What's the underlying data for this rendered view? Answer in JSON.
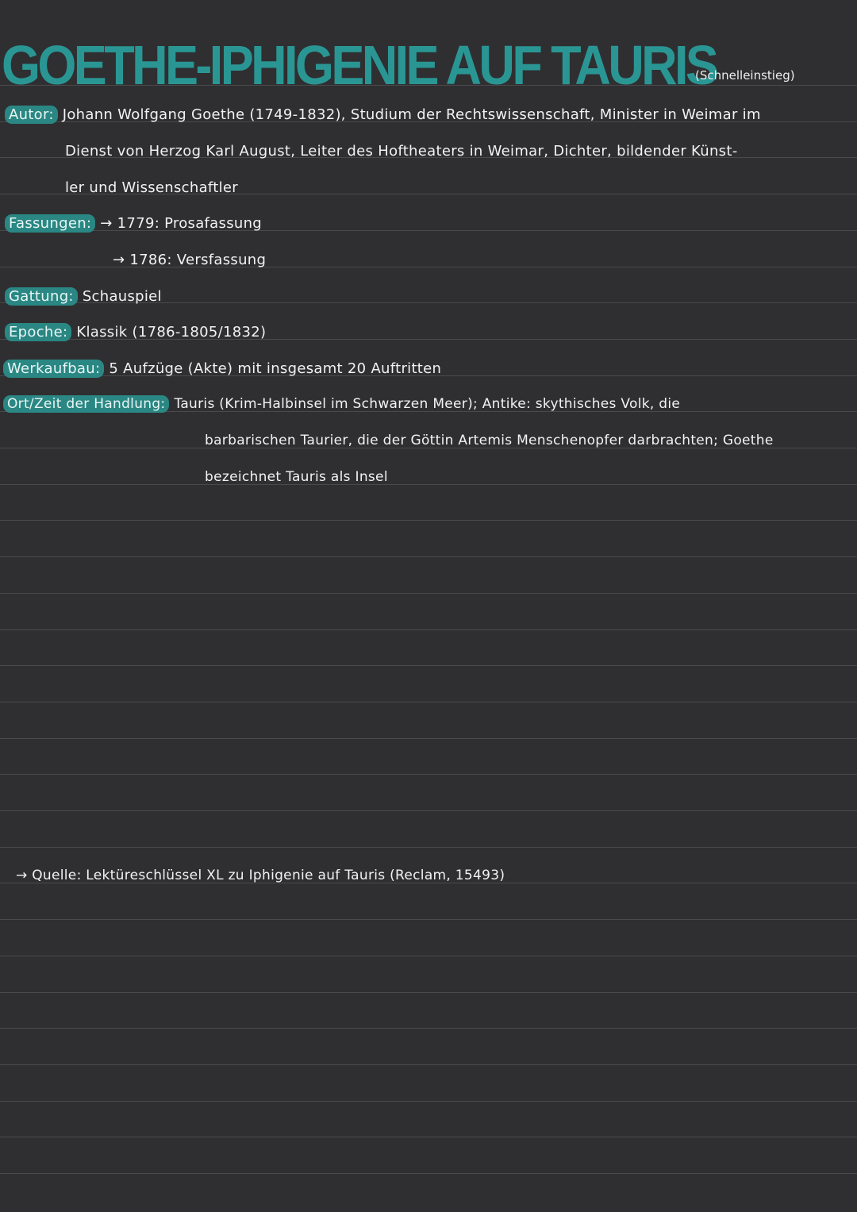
{
  "title": "GOETHE-IPHIGENIE AUF TAURIS",
  "subtitle": "(Schnelleinstieg)",
  "colors": {
    "background": "#2f2f31",
    "accent": "#2a9694",
    "label_highlight": "#2a8783",
    "ruling": "#4a4a4c"
  },
  "entries": [
    {
      "label": "Autor:",
      "lines": [
        "Johann Wolfgang Goethe (1749-1832), Studium der Rechtswissenschaft, Minister in Weimar im",
        "Dienst von Herzog Karl August, Leiter des Hoftheaters in Weimar, Dichter, bildender Künst-",
        "ler und Wissenschaftler"
      ]
    },
    {
      "label": "Fassungen:",
      "lines": [
        "→ 1779: Prosafassung",
        "→ 1786: Versfassung"
      ]
    },
    {
      "label": "Gattung:",
      "lines": [
        "Schauspiel"
      ]
    },
    {
      "label": "Epoche:",
      "lines": [
        "Klassik (1786-1805/1832)"
      ]
    },
    {
      "label": "Werkaufbau:",
      "lines": [
        "5 Aufzüge (Akte) mit insgesamt 20 Auftritten"
      ]
    },
    {
      "label": "Ort/Zeit der Handlung:",
      "lines": [
        "Tauris (Krim-Halbinsel im Schwarzen Meer); Antike: skythisches Volk, die",
        "barbarischen Taurier, die der Göttin Artemis Menschenopfer darbrachten; Goethe",
        "bezeichnet Tauris als Insel"
      ]
    }
  ],
  "source": "→ Quelle: Lektüreschlüssel XL zu Iphigenie auf Tauris (Reclam, 15493)"
}
